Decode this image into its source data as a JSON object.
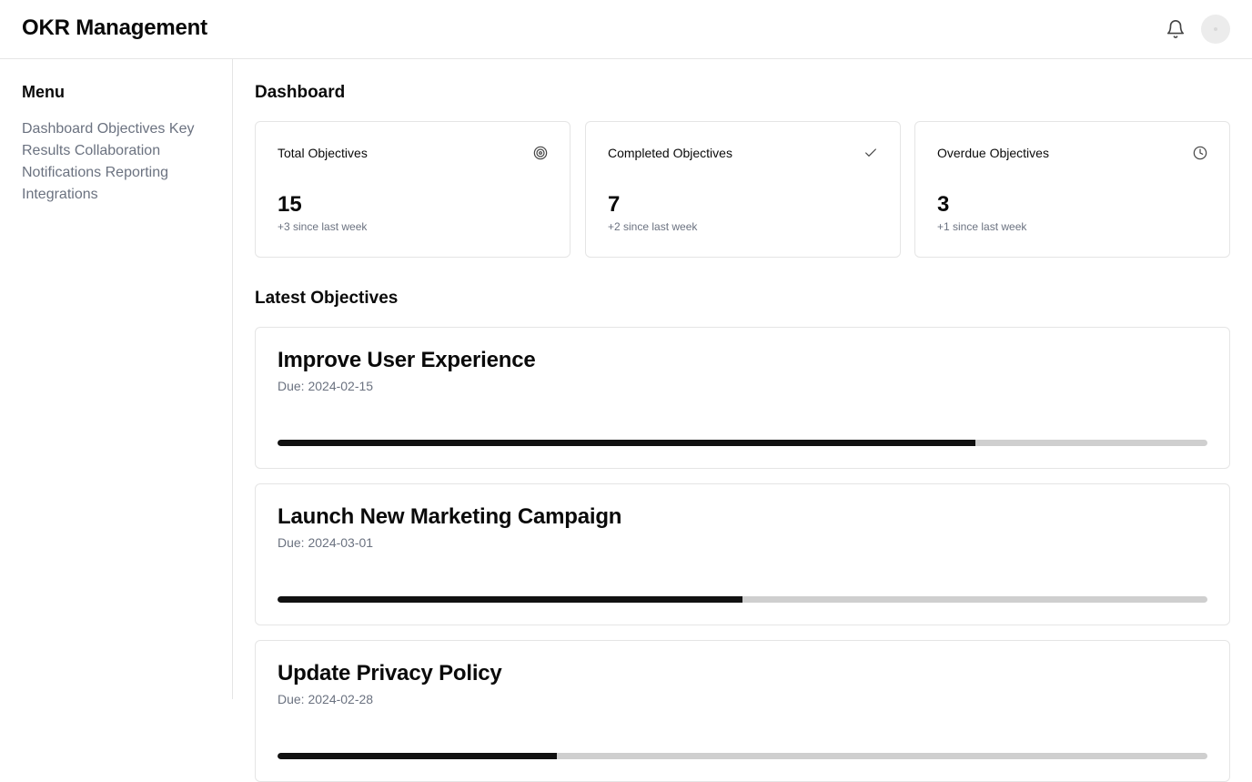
{
  "app": {
    "title": "OKR Management"
  },
  "header": {
    "bell_icon": "bell-icon",
    "avatar": "avatar"
  },
  "sidebar": {
    "title": "Menu",
    "items": [
      {
        "label": "Dashboard"
      },
      {
        "label": "Objectives"
      },
      {
        "label": "Key Results"
      },
      {
        "label": "Collaboration"
      },
      {
        "label": "Notifications"
      },
      {
        "label": "Reporting"
      },
      {
        "label": "Integrations"
      }
    ]
  },
  "dashboard": {
    "title": "Dashboard",
    "stats": [
      {
        "label": "Total Objectives",
        "value": "15",
        "sub": "+3 since last week",
        "icon": "target-icon"
      },
      {
        "label": "Completed Objectives",
        "value": "7",
        "sub": "+2 since last week",
        "icon": "check-icon"
      },
      {
        "label": "Overdue Objectives",
        "value": "3",
        "sub": "+1 since last week",
        "icon": "clock-icon"
      }
    ]
  },
  "latest": {
    "title": "Latest Objectives",
    "objectives": [
      {
        "title": "Improve User Experience",
        "due": "Due: 2024-02-15",
        "progress": 0.75
      },
      {
        "title": "Launch New Marketing Campaign",
        "due": "Due: 2024-03-01",
        "progress": 0.5
      },
      {
        "title": "Update Privacy Policy",
        "due": "Due: 2024-02-28",
        "progress": 0.3
      }
    ]
  },
  "colors": {
    "progress_fill": "#111111",
    "progress_track": "#cfcfcf",
    "muted_text": "#6b7280",
    "border": "#e5e5e5"
  }
}
